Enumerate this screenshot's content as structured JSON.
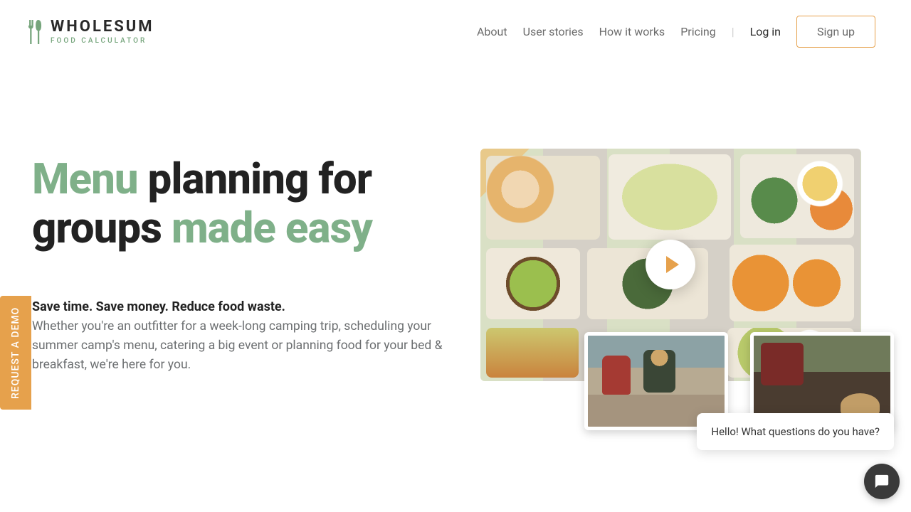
{
  "brand": {
    "name": "WHOLESUM",
    "subtitle": "FOOD CALCULATOR",
    "accent": "#76a57c"
  },
  "nav": {
    "items": [
      {
        "label": "About"
      },
      {
        "label": "User stories"
      },
      {
        "label": "How it works"
      },
      {
        "label": "Pricing"
      }
    ],
    "login": "Log in",
    "signup": "Sign up"
  },
  "hero": {
    "headline_parts": {
      "p1": "Menu",
      "p2": " planning for groups ",
      "p3": "made easy"
    },
    "tagline": "Save time. Save money. Reduce food waste.",
    "body": "Whether you're an outfitter for a week-long camping trip, scheduling your summer camp's menu, catering a big event or planning food for your bed & breakfast, we're here for you."
  },
  "demo_tab": "REQUEST A DEMO",
  "chat": {
    "greeting": "Hello! What questions do you have?"
  },
  "colors": {
    "accent_green": "#7fb089",
    "accent_orange": "#e6a14c"
  }
}
